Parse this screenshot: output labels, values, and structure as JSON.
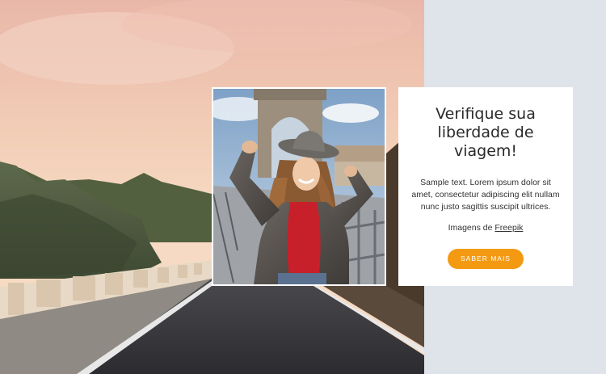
{
  "card": {
    "title": "Verifique sua liberdade de viagem!",
    "body": "Sample text. Lorem ipsum dolor sit amet, consectetur adipiscing elit nullam nunc justo sagittis suscipit ultrices.",
    "credit_prefix": "Imagens de",
    "credit_link": "Freepik",
    "button_label": "SABER MAIS"
  },
  "colors": {
    "accent": "#f39a12",
    "panel": "#dfe3ea",
    "card": "#ffffff"
  }
}
